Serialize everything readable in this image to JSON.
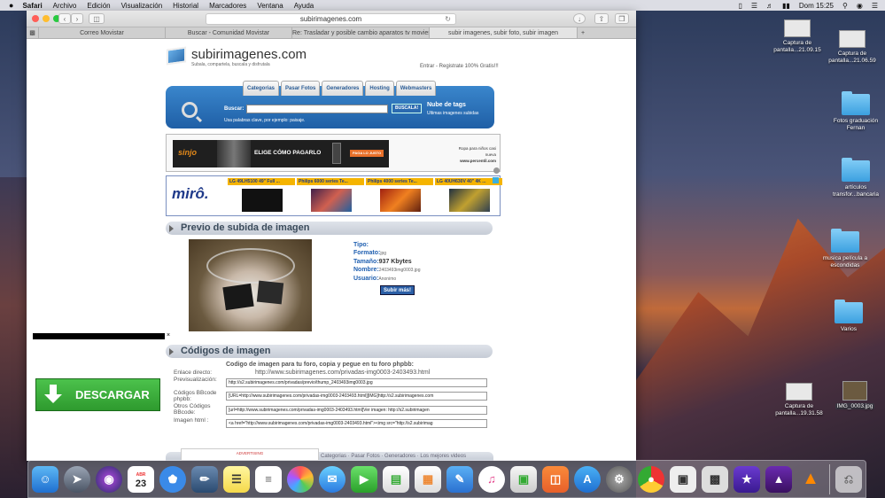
{
  "menubar": {
    "apple": "",
    "items": [
      "Safari",
      "Archivo",
      "Edición",
      "Visualización",
      "Historial",
      "Marcadores",
      "Ventana",
      "Ayuda"
    ],
    "clock": "Dom 15:25"
  },
  "browser": {
    "address": "subirimagenes.com",
    "tabs": [
      "Correo Movistar",
      "Buscar - Comunidad Movistar",
      "Re: Trasladar y posible cambio aparatos tv moviest...",
      "subir imagenes, subir foto, subir imagen"
    ]
  },
  "site": {
    "logo_text": "subirimagenes.com",
    "slogan": "Subala, compartela, buscala y disfrutala",
    "login_line": "Entrar - Registrate 100% Gratis!!!",
    "nav": [
      "Categorias",
      "Pasar Fotos",
      "Generadores",
      "Hosting",
      "Webmasters"
    ],
    "search_label": "Buscar:",
    "search_button": "BUSCALA!",
    "search_hint": "Usa palabras clave, por ejemplo: paisaje.",
    "tags_title": "Nube de tags",
    "tags_sub": "Ultimas imagenes subidas"
  },
  "ad1": {
    "brand": "sinjo",
    "headline": "ELIGE CÓMO PAGARLO",
    "cta": "PAGA LO JUSTO",
    "side_text": "Ropa para niños casi nueva",
    "side_site": "www.percentil.com"
  },
  "ad2": {
    "logo": "mirô.",
    "items": [
      "LG 49LH5100 49\" Full ...",
      "Philips 6000 series Te...",
      "Philips 4000 series Te...",
      "LG 40UH630V 40\" 4K ..."
    ]
  },
  "preview": {
    "section_title": "Previo de subida de imagen",
    "tipo_label": "Tipo:",
    "formato_label": "Formato:",
    "formato_value": "jpg",
    "tamano_label": "Tamaño:",
    "tamano_value": "937 Kbytes",
    "nombre_label": "Nombre:",
    "nombre_value": "2403493img0003.jpg",
    "usuario_label": "Usuario:",
    "usuario_value": "Anonimo",
    "upload_more": "Subir más!"
  },
  "codes": {
    "section_title": "Códigos de imagen",
    "heading": "Codigo de imagen para tu foro, copia y pegue en tu foro phpbb:",
    "direct_label": "Enlace directo:",
    "direct_url": "http://www.subirimagenes.com/privadas-img0003-2403493.html",
    "rows": [
      {
        "label": "Previsualización:",
        "value": "http://s2.subirimagenes.com/privadas/previo/thump_2403493img0003.jpg"
      },
      {
        "label": "Códigos BBcode phpbb:",
        "value": "[URL=http://www.subirimagenes.com/privadas-img0003-2403493.html][IMG]http://s2.subirimagenes.com"
      },
      {
        "label": "Otros Códigos BBcode:",
        "value": "[url=http://www.subirimagenes.com/privadas-img0003-2403493.html]Ver imagen: http://s2.subirimagen"
      },
      {
        "label": "Imagen html :",
        "value": "<a href=\"http://www.subirimagenes.com/privadas-img0003-2403493.html\"><img src=\"http://s2.subirimag"
      }
    ]
  },
  "download": {
    "label": "DESCARGAR"
  },
  "bottom": {
    "ad_label": "ADVERTISING",
    "links": "Categorias · Pasar Fotos · Generadores · Los mejores videos"
  },
  "desktop": {
    "icons": [
      {
        "label": "Captura de pantalla...21.09.15"
      },
      {
        "label": "Captura de pantalla...21.06.59"
      },
      {
        "label": "Fotos graduación Fernan"
      },
      {
        "label": "artículos transfor...bancaria"
      },
      {
        "label": "musica película a escondidas"
      },
      {
        "label": "Varios"
      },
      {
        "label": "Captura de pantalla...19.31.58"
      },
      {
        "label": "IMG_0003.jpg"
      }
    ]
  },
  "dock": {
    "calendar_month": "ABR",
    "calendar_day": "23"
  }
}
